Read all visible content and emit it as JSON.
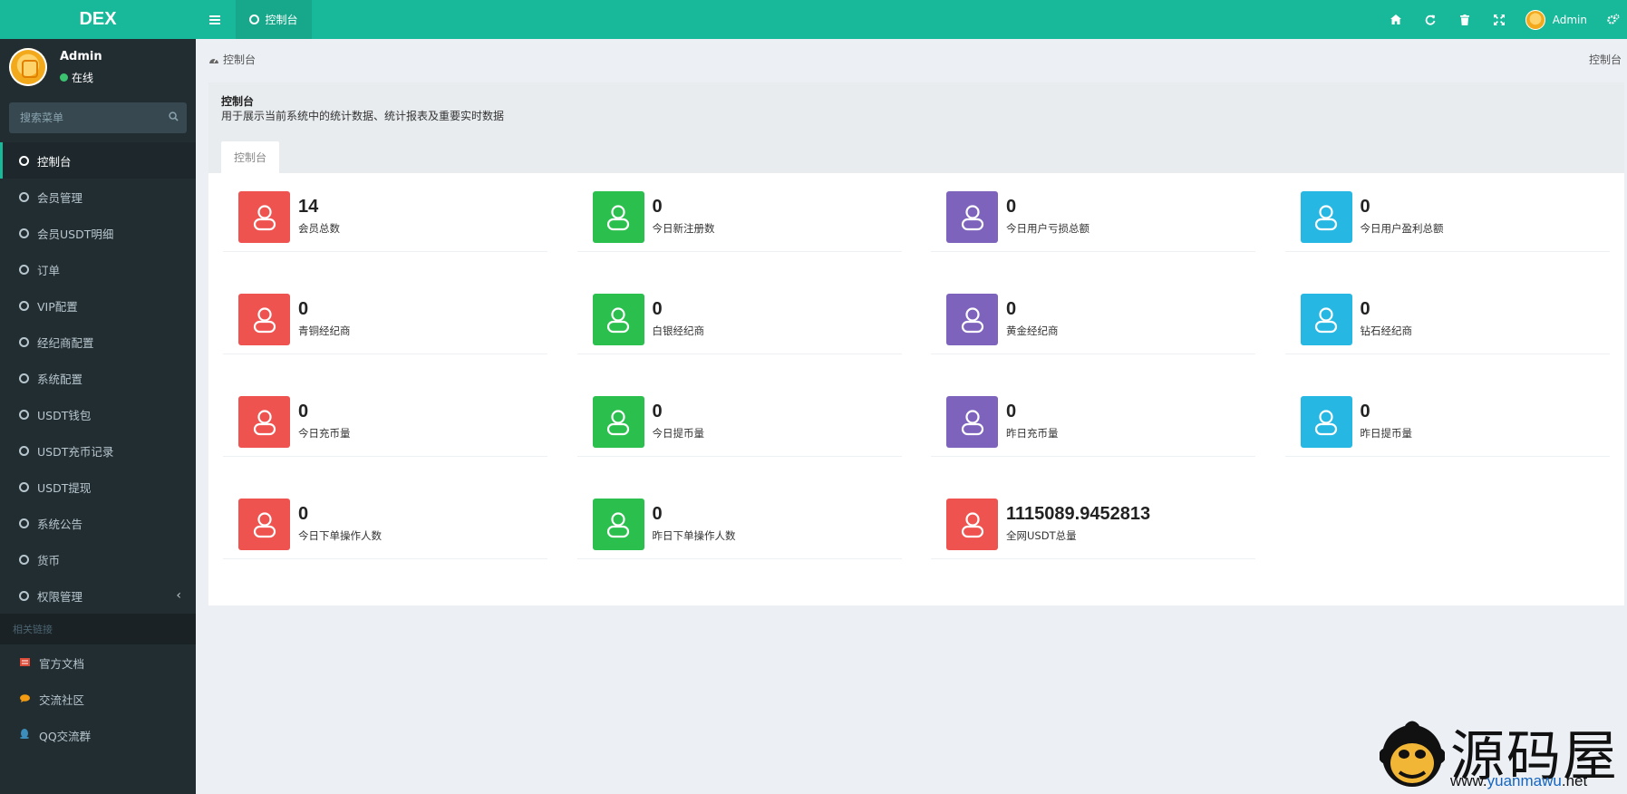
{
  "app": {
    "logo": "DEX"
  },
  "user": {
    "name": "Admin",
    "status": "在线"
  },
  "search": {
    "placeholder": "搜索菜单"
  },
  "menu": [
    {
      "label": "控制台",
      "active": true
    },
    {
      "label": "会员管理"
    },
    {
      "label": "会员USDT明细"
    },
    {
      "label": "订单"
    },
    {
      "label": "VIP配置"
    },
    {
      "label": "经纪商配置"
    },
    {
      "label": "系统配置"
    },
    {
      "label": "USDT钱包"
    },
    {
      "label": "USDT充币记录"
    },
    {
      "label": "USDT提现"
    },
    {
      "label": "系统公告"
    },
    {
      "label": "货币"
    },
    {
      "label": "权限管理",
      "has_children": true
    }
  ],
  "links_header": "相关链接",
  "links": [
    {
      "label": "官方文档",
      "icon": "book-icon",
      "color": "#dd4b39"
    },
    {
      "label": "交流社区",
      "icon": "comment-icon",
      "color": "#f39c12"
    },
    {
      "label": "QQ交流群",
      "icon": "qq-icon",
      "color": "#3c8dbc"
    }
  ],
  "topbar": {
    "tab_label": "控制台",
    "user_name": "Admin",
    "icons": [
      "home-icon",
      "refresh-icon",
      "trash-icon",
      "fullscreen-icon",
      "settings-icon"
    ]
  },
  "breadcrumb": {
    "left": "控制台",
    "right": "控制台"
  },
  "panel": {
    "title": "控制台",
    "subtitle": "用于展示当前系统中的统计数据、统计报表及重要实时数据",
    "tab": "控制台"
  },
  "colors": {
    "red": "#ef5350",
    "green": "#2bbf4e",
    "purple": "#7e63bd",
    "cyan": "#26b7e3",
    "accent": "#18b99a"
  },
  "stats": [
    {
      "value": "14",
      "label": "会员总数",
      "color": "red"
    },
    {
      "value": "0",
      "label": "今日新注册数",
      "color": "green"
    },
    {
      "value": "0",
      "label": "今日用户亏损总额",
      "color": "purple"
    },
    {
      "value": "0",
      "label": "今日用户盈利总额",
      "color": "cyan"
    },
    {
      "value": "0",
      "label": "青铜经纪商",
      "color": "red"
    },
    {
      "value": "0",
      "label": "白银经纪商",
      "color": "green"
    },
    {
      "value": "0",
      "label": "黄金经纪商",
      "color": "purple"
    },
    {
      "value": "0",
      "label": "钻石经纪商",
      "color": "cyan"
    },
    {
      "value": "0",
      "label": "今日充币量",
      "color": "red"
    },
    {
      "value": "0",
      "label": "今日提币量",
      "color": "green"
    },
    {
      "value": "0",
      "label": "昨日充币量",
      "color": "purple"
    },
    {
      "value": "0",
      "label": "昨日提币量",
      "color": "cyan"
    },
    {
      "value": "0",
      "label": "今日下单操作人数",
      "color": "red"
    },
    {
      "value": "0",
      "label": "昨日下单操作人数",
      "color": "green"
    },
    {
      "value": "1115089.9452813",
      "label": "全网USDT总量",
      "color": "red"
    }
  ],
  "watermark": {
    "text": "源码屋",
    "url_a": "www.",
    "url_b": "yuanmawu",
    "url_c": ".net"
  }
}
